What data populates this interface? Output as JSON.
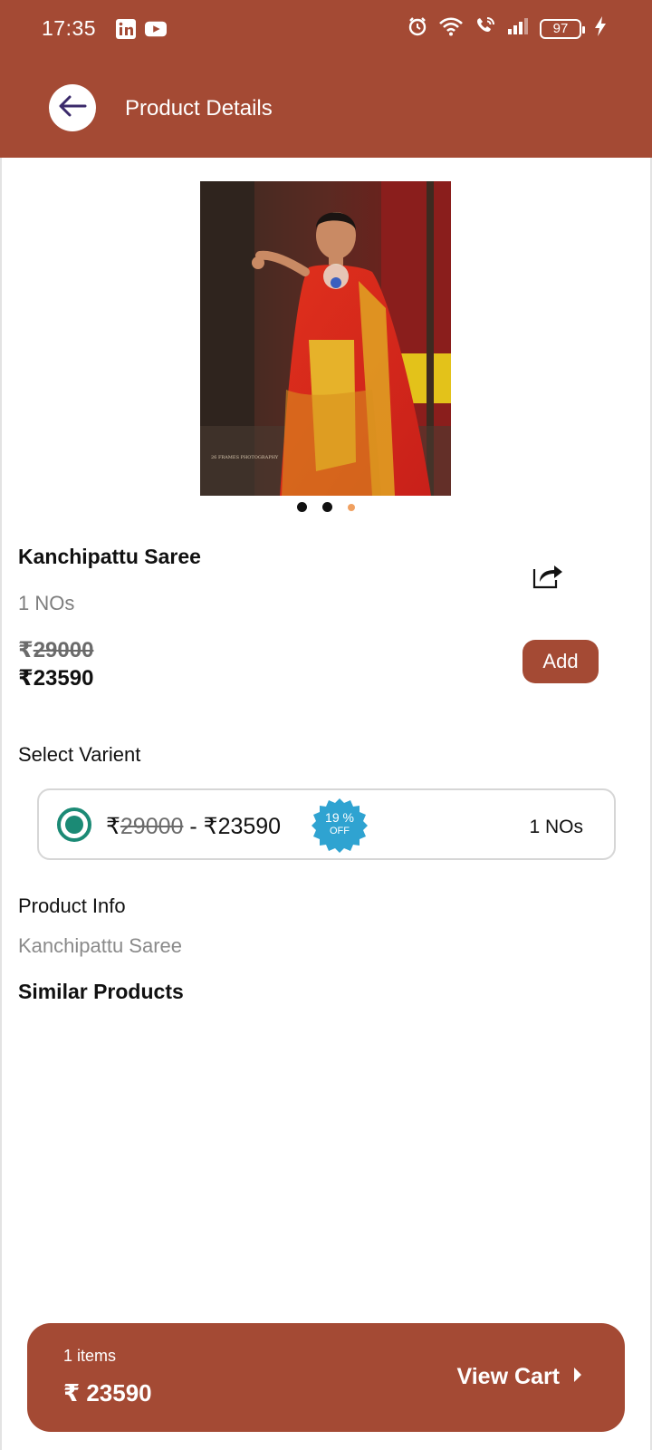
{
  "status_bar": {
    "time": "17:35",
    "battery": "97",
    "apps": [
      "linkedin-icon",
      "youtube-icon"
    ],
    "indicators": [
      "alarm-icon",
      "wifi-icon",
      "wifi-call-icon",
      "signal-icon",
      "battery-icon",
      "charging-icon"
    ]
  },
  "header": {
    "title": "Product Details",
    "back_icon": "arrow-left-icon"
  },
  "carousel": {
    "image_alt": "Kanchipattu Saree",
    "dots": 3,
    "active_index": 2,
    "watermark": "26 FRAMES PHOTOGRAPHY"
  },
  "product": {
    "name": "Kanchipattu Saree",
    "unit": "1 NOs",
    "currency": "₹",
    "mrp": "29000",
    "price": "23590",
    "add_label": "Add",
    "share_icon": "share-icon"
  },
  "variants": {
    "label": "Select Varient",
    "items": [
      {
        "currency": "₹",
        "mrp": "29000",
        "separator": " - ",
        "price": "23590",
        "discount_value": "19 %",
        "discount_label": "OFF",
        "unit": "1 NOs",
        "selected": true
      }
    ]
  },
  "product_info": {
    "label": "Product Info",
    "value": "Kanchipattu Saree"
  },
  "similar": {
    "title": "Similar Products"
  },
  "cart": {
    "items_text": "1  items",
    "total_text": "₹ 23590",
    "view_label": "View Cart"
  },
  "colors": {
    "brand": "#a44a34",
    "radio": "#1b8a75",
    "badge": "#2fa3d1",
    "dot_active": "#f0a060"
  }
}
